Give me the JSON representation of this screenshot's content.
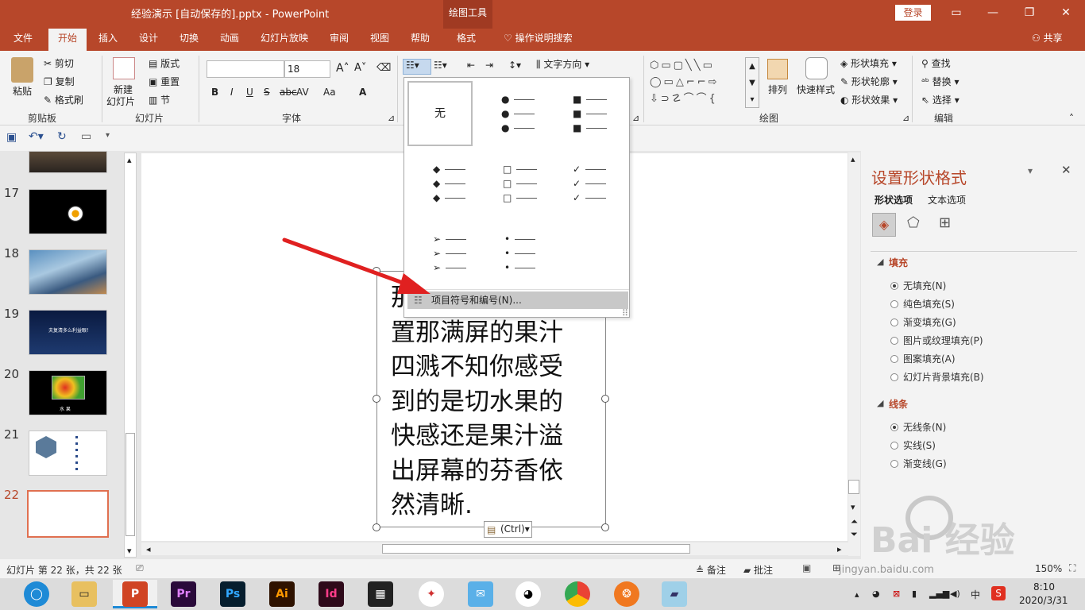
{
  "window": {
    "title": "经验演示 [自动保存的].pptx  -  PowerPoint",
    "context_tool": "绘图工具",
    "login": "登录"
  },
  "tabs": [
    "文件",
    "开始",
    "插入",
    "设计",
    "切换",
    "动画",
    "幻灯片放映",
    "审阅",
    "视图",
    "帮助",
    "格式"
  ],
  "tell_me": "操作说明搜索",
  "share": "共享",
  "ribbon": {
    "clipboard": {
      "paste": "粘贴",
      "cut": "剪切",
      "copy": "复制",
      "format_painter": "格式刷",
      "label": "剪贴板"
    },
    "slides": {
      "new_slide_1": "新建",
      "new_slide_2": "幻灯片",
      "layout": "版式",
      "reset": "重置",
      "section": "节",
      "label": "幻灯片"
    },
    "font": {
      "font_size": "18",
      "label": "字体",
      "bold": "B",
      "italic": "I",
      "underline": "U",
      "strike": "S",
      "spacing": "AV",
      "case": "Aa"
    },
    "paragraph": {
      "text_direction": "文字方向"
    },
    "drawing": {
      "arrange": "排列",
      "quick_styles": "快速样式",
      "fill": "形状填充",
      "outline": "形状轮廓",
      "effects": "形状效果",
      "label": "绘图"
    },
    "editing": {
      "find": "查找",
      "replace": "替换",
      "select": "选择",
      "label": "编辑"
    }
  },
  "thumbnails": {
    "numbers": [
      "17",
      "18",
      "19",
      "20",
      "21",
      "22"
    ],
    "slide19_text": "夫复清多么利益眼！",
    "slide20_text": "水 果"
  },
  "bullet_dropdown": {
    "none_label": "无",
    "bullets": [
      "●",
      "■",
      "◆",
      "□",
      "✓",
      "➢",
      "•"
    ],
    "footer": "项目符号和编号(N)..."
  },
  "slide_text": {
    "first_glyph": "那",
    "lines": [
      "置那满屏的果汁",
      "四溅不知你感受",
      "到的是切水果的",
      "快感还是果汁溢",
      "出屏幕的芬香依",
      "然清晰."
    ]
  },
  "paste_options": "(Ctrl)",
  "format_pane": {
    "title": "设置形状格式",
    "tab_shape": "形状选项",
    "tab_text": "文本选项",
    "fill_section": "填充",
    "fill_options": [
      {
        "label": "无填充(N)",
        "selected": true
      },
      {
        "label": "纯色填充(S)",
        "selected": false
      },
      {
        "label": "渐变填充(G)",
        "selected": false
      },
      {
        "label": "图片或纹理填充(P)",
        "selected": false
      },
      {
        "label": "图案填充(A)",
        "selected": false
      },
      {
        "label": "幻灯片背景填充(B)",
        "selected": false
      }
    ],
    "line_section": "线条",
    "line_options": [
      {
        "label": "无线条(N)",
        "selected": true
      },
      {
        "label": "实线(S)",
        "selected": false
      },
      {
        "label": "渐变线(G)",
        "selected": false
      }
    ]
  },
  "status": {
    "slide_info": "幻灯片 第 22 张，共 22 张",
    "notes": "备注",
    "comments": "批注",
    "zoom": "150%"
  },
  "taskbar": {
    "apps": [
      "Pr",
      "Ps",
      "Ai",
      "Id"
    ],
    "time": "8:10",
    "date": "2020/3/31",
    "ime": "中"
  },
  "watermark": {
    "text": "Bai 经验",
    "url": "jingyan.baidu.com"
  },
  "colors": {
    "accent": "#b7472a",
    "annotation_arrow": "#e02020"
  }
}
